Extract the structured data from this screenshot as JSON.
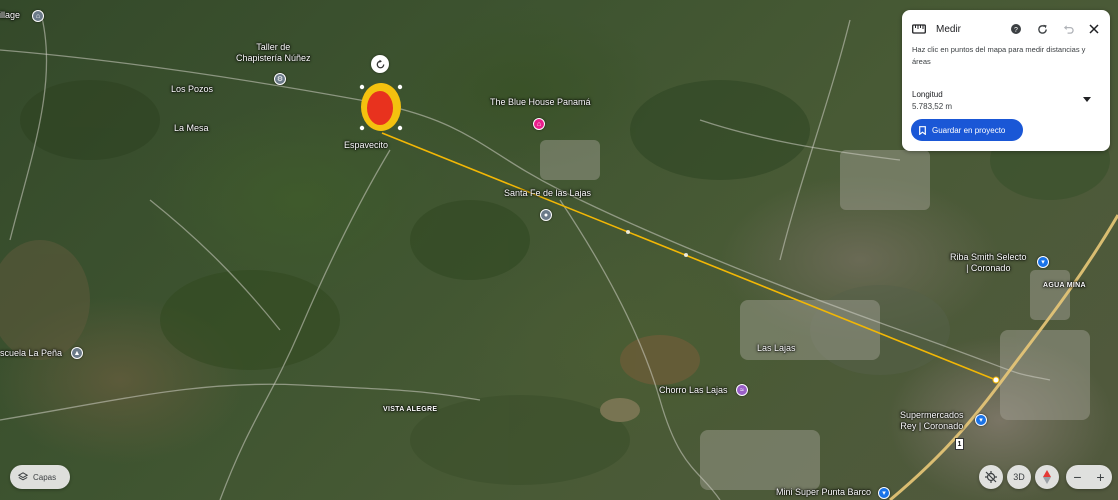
{
  "map": {
    "place_labels": [
      {
        "text": "illage"
      },
      {
        "text": "Taller de\nChapistería Núñez"
      },
      {
        "text": "Los Pozos"
      },
      {
        "text": "La Mesa"
      },
      {
        "text": "Espavecito"
      },
      {
        "text": "The Blue House Panamá"
      },
      {
        "text": "Santa Fe de las Lajas"
      },
      {
        "text": "Riba Smith Selecto\n| Coronado"
      },
      {
        "text": "AGUA MINA"
      },
      {
        "text": "scuela La Peña"
      },
      {
        "text": "Las Lajas"
      },
      {
        "text": "Chorro Las Lajas"
      },
      {
        "text": "VISTA ALEGRE"
      },
      {
        "text": "Supermercados\nRey | Coronado"
      },
      {
        "text": "Mini Super Punta Barco"
      }
    ],
    "road_shield": "1",
    "measure_line_color": "#f2b705",
    "marker_colors": {
      "fill": "#e8321e",
      "ring": "#f4c10f"
    }
  },
  "measure_panel": {
    "title": "Medir",
    "description": "Haz clic en puntos del mapa para medir distancias y áreas",
    "length_label": "Longitud",
    "length_value": "5.783,52 m",
    "save_button": "Guardar en proyecto",
    "icons": [
      "ruler-icon",
      "help-icon",
      "refresh-icon",
      "undo-icon",
      "close-icon",
      "chevron-down-icon",
      "bookmark-icon"
    ]
  },
  "controls": {
    "layers_label": "Capas",
    "view_3d_label": "3D",
    "zoom_in": "+",
    "zoom_out": "−"
  }
}
